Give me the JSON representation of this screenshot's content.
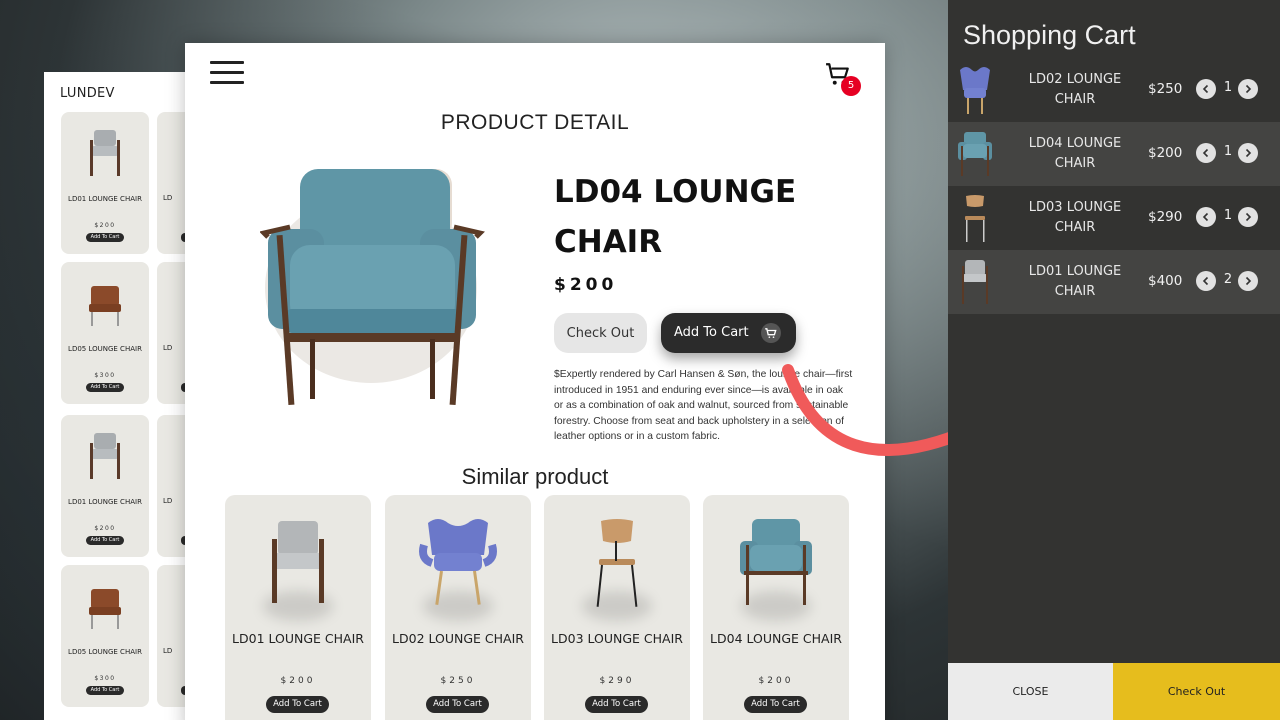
{
  "back_page": {
    "brand": "LUNDEV",
    "cards": [
      {
        "name": "LD01 LOUNGE CHAIR",
        "price": "$200",
        "button": "Add To Cart",
        "partial_label": "LD",
        "color": "#9ea4a7"
      },
      {
        "name": "LD05 LOUNGE CHAIR",
        "price": "$300",
        "button": "Add To Cart",
        "partial_label": "LD",
        "color": "#8b4a2a"
      },
      {
        "name": "LD01 LOUNGE CHAIR",
        "price": "$200",
        "button": "Add To Cart",
        "partial_label": "LD",
        "color": "#9ea4a7"
      },
      {
        "name": "LD05 LOUNGE CHAIR",
        "price": "$300",
        "button": "Add To Cart",
        "partial_label": "LD",
        "color": "#8b4a2a"
      }
    ]
  },
  "header": {
    "menu_icon": "hamburger-icon",
    "cart_icon": "cart-icon",
    "cart_count": "5"
  },
  "page_title": "PRODUCT DETAIL",
  "product": {
    "name": "LD04 LOUNGE CHAIR",
    "price": "$200",
    "checkout_label": "Check Out",
    "add_to_cart_label": "Add To Cart",
    "description": "$Expertly rendered by Carl Hansen & Søn, the lounge chair—first introduced in 1951 and enduring ever since—is available in oak or as a combination of oak and walnut, sourced from sustainable forestry. Choose from seat and back upholstery in a selection of leather options or in a custom fabric."
  },
  "similar": {
    "title": "Similar product",
    "items": [
      {
        "name": "LD01 LOUNGE CHAIR",
        "price": "$200",
        "button": "Add To Cart"
      },
      {
        "name": "LD02 LOUNGE CHAIR",
        "price": "$250",
        "button": "Add To Cart"
      },
      {
        "name": "LD03 LOUNGE CHAIR",
        "price": "$290",
        "button": "Add To Cart"
      },
      {
        "name": "LD04 LOUNGE CHAIR",
        "price": "$200",
        "button": "Add To Cart"
      }
    ]
  },
  "cart": {
    "title": "Shopping Cart",
    "items": [
      {
        "name": "LD02 LOUNGE CHAIR",
        "price": "$250",
        "qty": "1"
      },
      {
        "name": "LD04 LOUNGE CHAIR",
        "price": "$200",
        "qty": "1"
      },
      {
        "name": "LD03 LOUNGE CHAIR",
        "price": "$290",
        "qty": "1"
      },
      {
        "name": "LD01 LOUNGE CHAIR",
        "price": "$400",
        "qty": "2"
      }
    ],
    "close_label": "CLOSE",
    "checkout_label": "Check Out"
  },
  "colors": {
    "accent_yellow": "#e6bd1d",
    "badge_red": "#e60023",
    "arrow_red": "#f05a5a",
    "panel_dark": "#333331"
  }
}
